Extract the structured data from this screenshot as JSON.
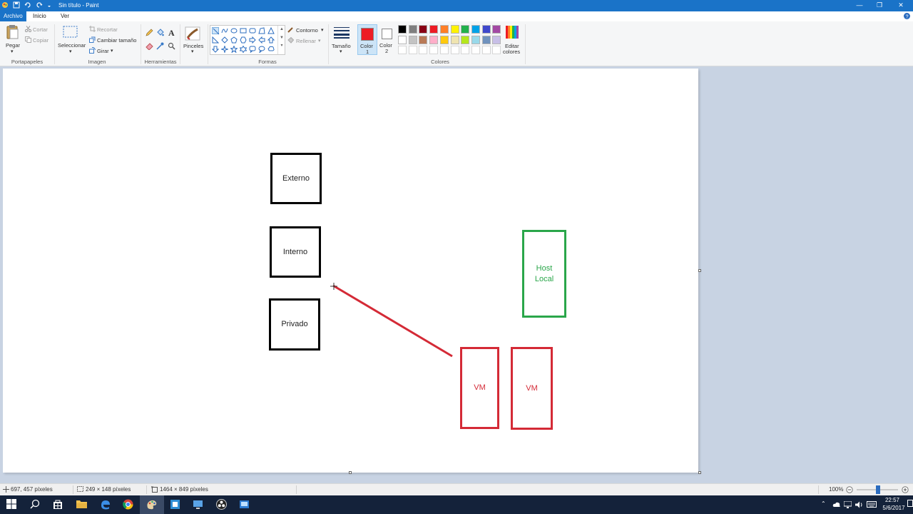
{
  "window": {
    "title": "Sin título - Paint"
  },
  "tabs": {
    "archivo": "Archivo",
    "inicio": "Inicio",
    "ver": "Ver"
  },
  "ribbon": {
    "clipboard": {
      "paste": "Pegar",
      "cut": "Cortar",
      "copy": "Copiar",
      "label": "Portapapeles"
    },
    "image": {
      "select": "Seleccionar",
      "crop": "Recortar",
      "resize": "Cambiar tamaño",
      "rotate": "Girar",
      "label": "Imagen"
    },
    "tools": {
      "label": "Herramientas",
      "text_glyph": "A"
    },
    "brushes": {
      "label": "Pinceles"
    },
    "shapes": {
      "outline": "Contorno",
      "fill": "Rellenar",
      "label": "Formas"
    },
    "size": {
      "label": "Tamaño"
    },
    "color1": {
      "line1": "Color",
      "line2": "1",
      "value": "#ed1c24"
    },
    "color2": {
      "line1": "Color",
      "line2": "2",
      "value": "#ffffff"
    },
    "colors": {
      "label": "Colores",
      "row1": [
        "#000000",
        "#7f7f7f",
        "#880015",
        "#ed1c24",
        "#ff7f27",
        "#fff200",
        "#22b14c",
        "#00a2e8",
        "#3f48cc",
        "#a349a4"
      ],
      "row2": [
        "#ffffff",
        "#c3c3c3",
        "#b97a57",
        "#ffaec9",
        "#ffc90e",
        "#efe4b0",
        "#b5e61d",
        "#99d9ea",
        "#7092be",
        "#c8bfe7"
      ],
      "row3": [
        "#ffffff",
        "#ffffff",
        "#ffffff",
        "#ffffff",
        "#ffffff",
        "#ffffff",
        "#ffffff",
        "#ffffff",
        "#ffffff",
        "#ffffff"
      ]
    },
    "edit_colors": {
      "line1": "Editar",
      "line2": "colores"
    }
  },
  "drawing": {
    "externo": "Externo",
    "interno": "Interno",
    "privado": "Privado",
    "host_line1": "Host",
    "host_line2": "Local",
    "vm1": "VM",
    "vm2": "VM",
    "colors": {
      "black": "#000000",
      "green": "#2aa64a",
      "red": "#d42a36"
    }
  },
  "status": {
    "cursor_pos": "697, 457 píxeles",
    "selection_size": "249 × 148 píxeles",
    "image_size": "1464 × 849 píxeles",
    "zoom": "100%"
  },
  "taskbar": {
    "time": "22:57",
    "date": "5/6/2017"
  }
}
